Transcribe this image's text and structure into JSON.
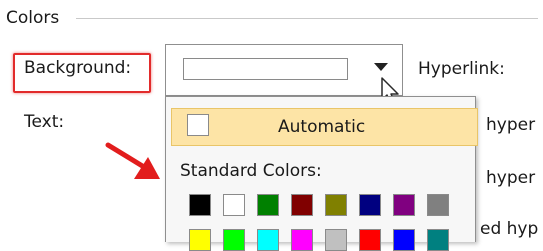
{
  "group": {
    "title": "Colors"
  },
  "labels": {
    "background": "Background:",
    "text": "Text:",
    "hyperlink": "Hyperlink:",
    "following1": "hyper",
    "following2": "hyper",
    "following3": "ed hyp"
  },
  "combo": {
    "selected_color": "#ffffff"
  },
  "dropdown": {
    "automatic_label": "Automatic",
    "standard_label": "Standard Colors:",
    "row1": [
      {
        "name": "black",
        "color": "#000000"
      },
      {
        "name": "white",
        "color": "#ffffff"
      },
      {
        "name": "green",
        "color": "#008000"
      },
      {
        "name": "maroon",
        "color": "#800000"
      },
      {
        "name": "olive",
        "color": "#808000"
      },
      {
        "name": "navy",
        "color": "#000080"
      },
      {
        "name": "purple",
        "color": "#800080"
      },
      {
        "name": "gray",
        "color": "#808080"
      }
    ],
    "row2": [
      {
        "name": "yellow",
        "color": "#ffff00"
      },
      {
        "name": "lime",
        "color": "#00ff00"
      },
      {
        "name": "aqua",
        "color": "#00ffff"
      },
      {
        "name": "fuchsia",
        "color": "#ff00ff"
      },
      {
        "name": "silver",
        "color": "#c0c0c0"
      },
      {
        "name": "red",
        "color": "#ff0000"
      },
      {
        "name": "blue",
        "color": "#0000ff"
      },
      {
        "name": "teal",
        "color": "#008080"
      }
    ]
  },
  "colors": {
    "highlight_border": "#e22b2b",
    "hover_fill": "#fde4a6",
    "annotation_arrow": "#e21d1d"
  }
}
